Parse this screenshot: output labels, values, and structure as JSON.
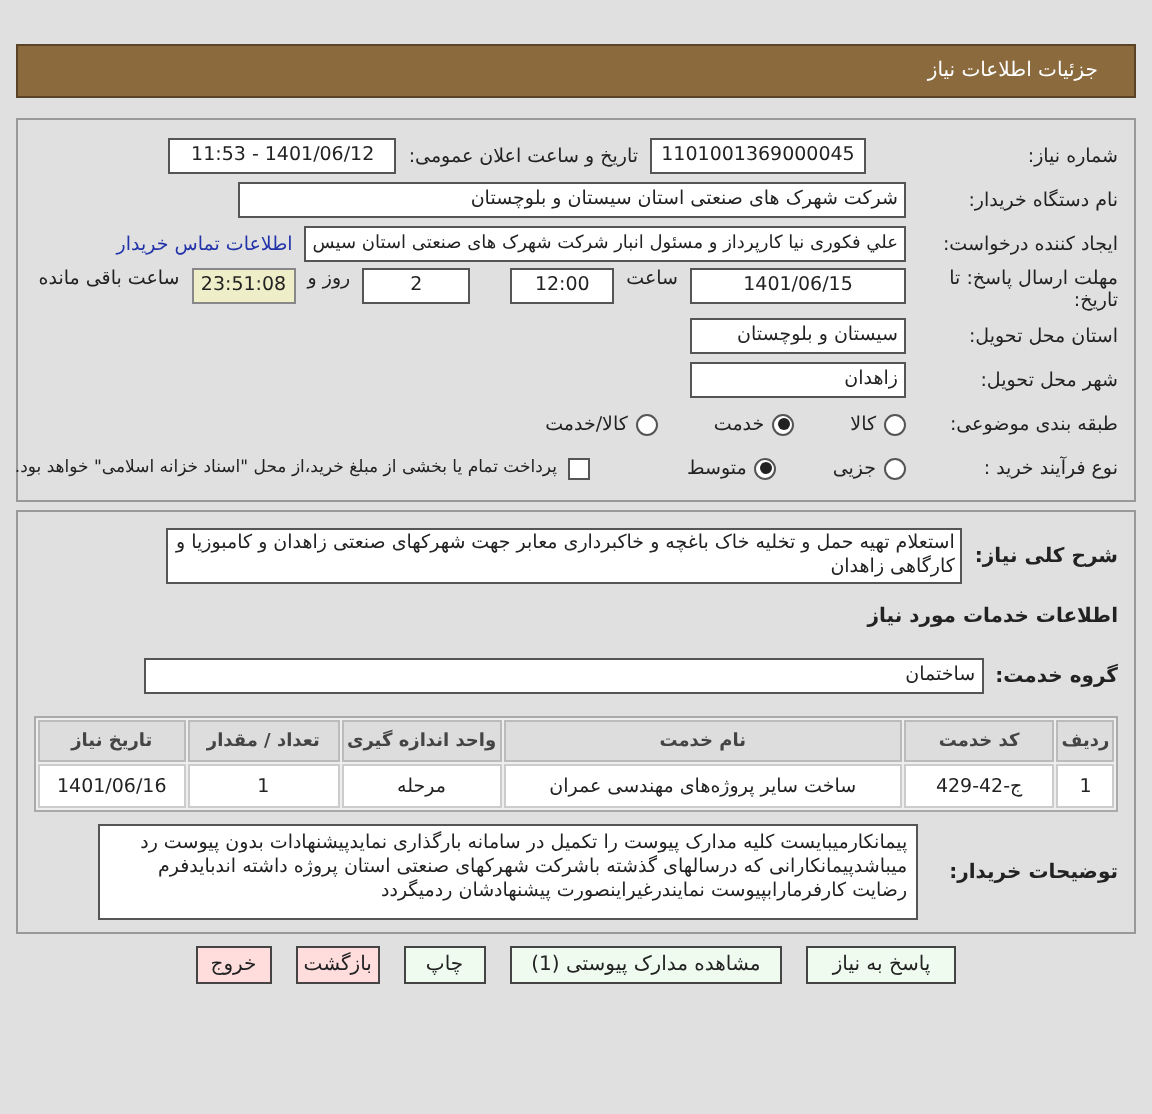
{
  "title": "جزئیات اطلاعات نیاز",
  "need": {
    "number_label": "شماره نیاز:",
    "number": "1101001369000045",
    "announce_label": "تاریخ و ساعت اعلان عمومی:",
    "announce": "1401/06/12 - 11:53",
    "buyer_label": "نام دستگاه خریدار:",
    "buyer": "شرکت شهرک های صنعتی استان سیستان و بلوچستان",
    "creator_label": "ایجاد کننده درخواست:",
    "creator": "علي  فکوری نیا کارپرداز و مسئول انبار شرکت شهرک های صنعتی استان سیس",
    "contact_link": "اطلاعات تماس خریدار",
    "deadline_label": "مهلت ارسال پاسخ: تا تاریخ:",
    "deadline_date": "1401/06/15",
    "time_label": "ساعت",
    "deadline_time": "12:00",
    "days": "2",
    "days_label": "روز و",
    "remaining": "23:51:08",
    "remaining_label": "ساعت باقی مانده",
    "province_label": "استان محل تحویل:",
    "province": "سیستان و بلوچستان",
    "city_label": "شهر محل تحویل:",
    "city": "زاهدان",
    "category_label": "طبقه بندی موضوعی:",
    "category_options": [
      {
        "label": "کالا",
        "selected": false
      },
      {
        "label": "خدمت",
        "selected": true
      },
      {
        "label": "کالا/خدمت",
        "selected": false
      }
    ],
    "process_label": "نوع فرآیند خرید :",
    "process_options": [
      {
        "label": "جزیی",
        "selected": false
      },
      {
        "label": "متوسط",
        "selected": true
      }
    ],
    "payment": {
      "checked": false,
      "label": "پرداخت تمام یا بخشی از مبلغ خرید،از محل \"اسناد خزانه اسلامی\" خواهد بود."
    }
  },
  "details": {
    "summary_label": "شرح کلی نیاز:",
    "summary": "استعلام تهیه حمل و تخلیه خاک باغچه و خاکبرداری معابر جهت شهرکهای صنعتی زاهدان و کامبوزیا و کارگاهی زاهدان",
    "services_heading": "اطلاعات خدمات مورد نیاز",
    "group_label": "گروه خدمت:",
    "group": "ساختمان",
    "table": {
      "columns": [
        "ردیف",
        "کد خدمت",
        "نام خدمت",
        "واحد اندازه گیری",
        "تعداد / مقدار",
        "تاریخ نیاز"
      ],
      "rows": [
        [
          "1",
          "ج-42-429",
          "ساخت سایر پروژه‌های مهندسی عمران",
          "مرحله",
          "1",
          "1401/06/16"
        ]
      ]
    },
    "notes_label": "توضیحات خریدار:",
    "notes": "پیمانکارمیبایست کلیه مدارک پیوست را تکمیل در سامانه بارگذاری نمایدپیشنهادات بدون پیوست رد میباشدپیمانکارانی که درسالهای گذشته باشرکت شهرکهای صنعتی استان پروژه داشته اندبایدفرم رضایت کارفرمارابپیوست نمایندرغیراینصورت پیشنهادشان ردمیگردد"
  },
  "buttons": [
    {
      "label": "پاسخ به نیاز",
      "kind": "primary"
    },
    {
      "label": "مشاهده مدارک پیوستی (1)",
      "kind": "primary"
    },
    {
      "label": "چاپ",
      "kind": "primary"
    },
    {
      "label": "بازگشت",
      "kind": "danger"
    },
    {
      "label": "خروج",
      "kind": "danger"
    }
  ]
}
